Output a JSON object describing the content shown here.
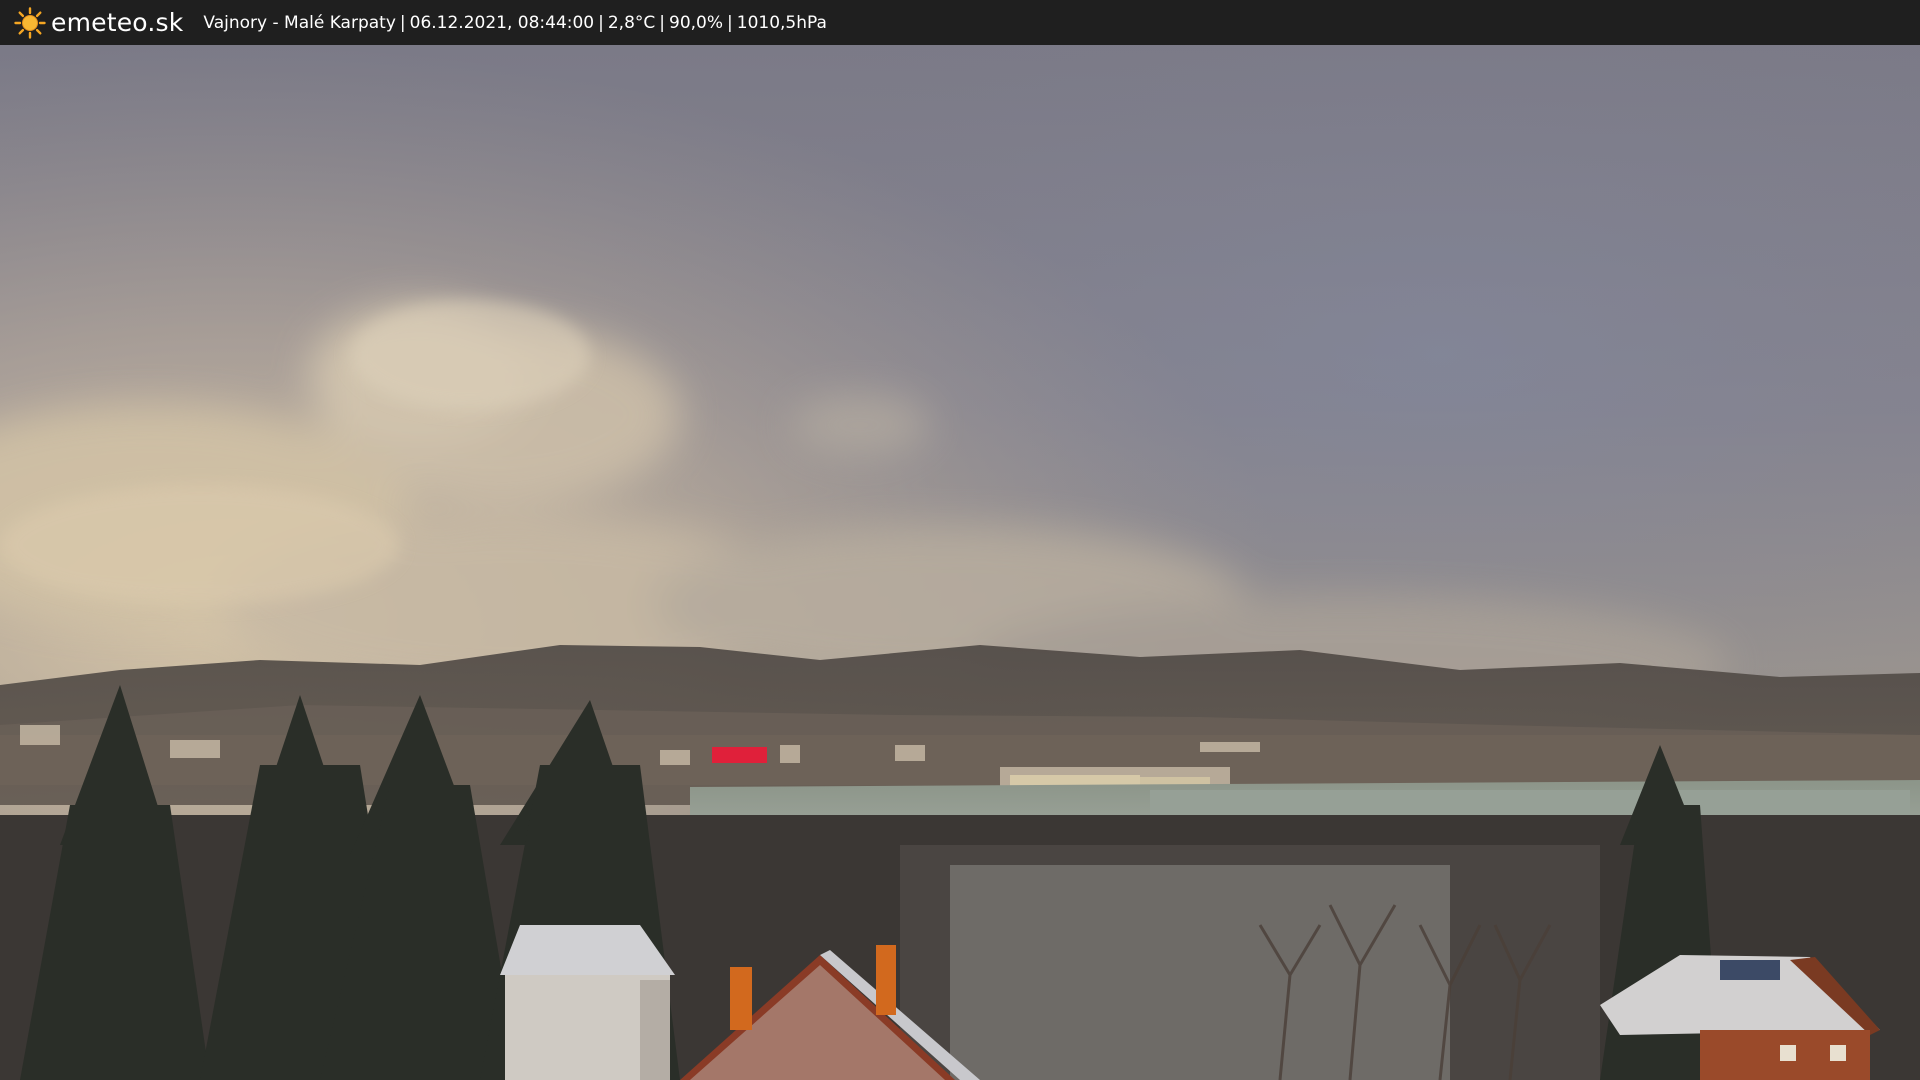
{
  "header": {
    "logo_text": "emeteo.sk",
    "logo_icon": "sun-icon",
    "location": "Vajnory - Malé Karpaty",
    "datetime": "06.12.2021, 08:44:00",
    "temperature": "2,8°C",
    "humidity": "90,0%",
    "pressure": "1010,5hPa",
    "separator": "|"
  },
  "colors": {
    "bar_background": "#1f1f1f",
    "text": "#ffffff",
    "sun": "#f5a623",
    "sky_top": "#7d7b88",
    "sky_horizon": "#a79d93",
    "cloud_warm": "#d4c4a8"
  }
}
